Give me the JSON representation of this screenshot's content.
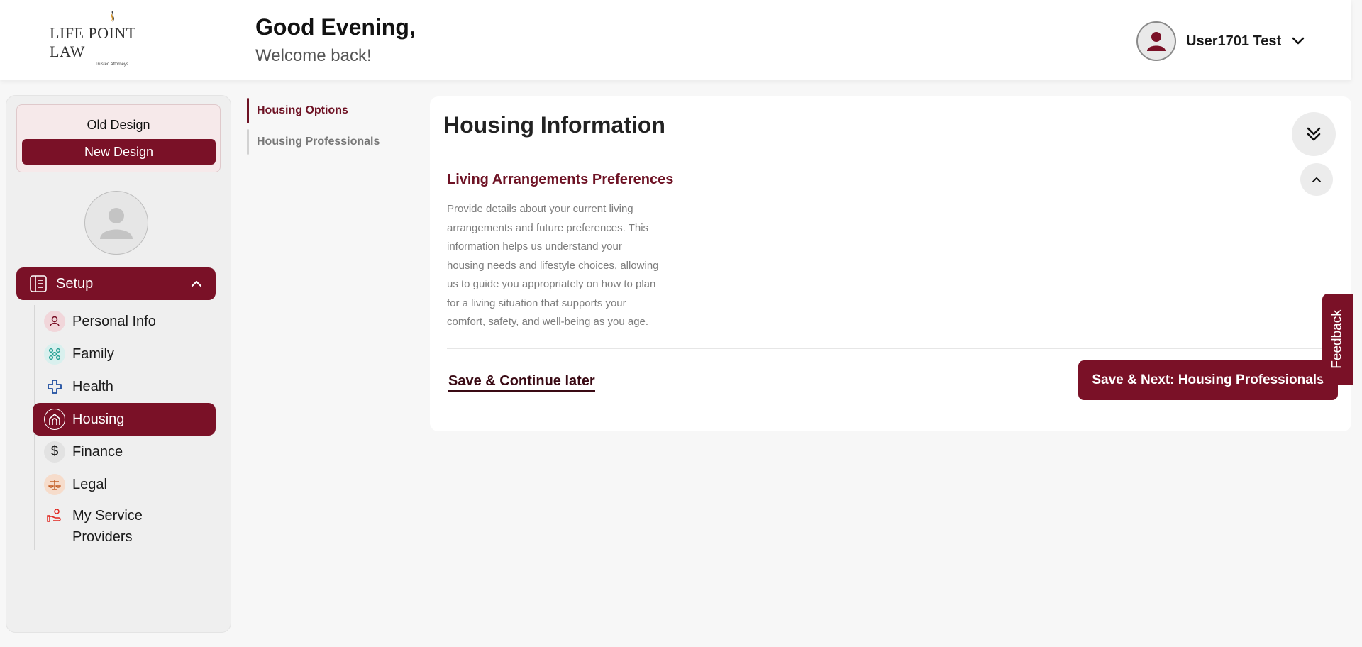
{
  "header": {
    "logo_text": "LIFE POINT LAW",
    "logo_tagline": "Trusted Attorneys",
    "greeting": "Good Evening,",
    "welcome": "Welcome back!",
    "user_name": "User1701 Test"
  },
  "sidebar": {
    "old_design": "Old Design",
    "new_design": "New Design",
    "setup_label": "Setup",
    "items": [
      {
        "label": "Personal Info",
        "icon": "person-icon"
      },
      {
        "label": "Family",
        "icon": "family-icon"
      },
      {
        "label": "Health",
        "icon": "health-cross-icon"
      },
      {
        "label": "Housing",
        "icon": "house-icon",
        "active": true
      },
      {
        "label": "Finance",
        "icon": "dollar-icon"
      },
      {
        "label": "Legal",
        "icon": "scales-icon"
      },
      {
        "label": "My Service Providers",
        "icon": "service-hand-icon"
      }
    ]
  },
  "subnav": {
    "items": [
      {
        "label": "Housing Options",
        "active": true
      },
      {
        "label": "Housing Professionals",
        "active": false
      }
    ]
  },
  "main": {
    "title": "Housing Information",
    "section_title": "Living Arrangements Preferences",
    "section_description": "Provide details about your current living arrangements and future preferences. This information helps us understand your housing needs and lifestyle choices, allowing us to guide you appropriately on how to plan for a living situation that supports your comfort, safety, and well-being as you age.",
    "save_later": "Save & Continue later",
    "save_next": "Save & Next: Housing Professionals"
  },
  "feedback_label": "Feedback",
  "colors": {
    "brand": "#7a1127",
    "brand_text": "#6e1224",
    "background": "#f7f7f7"
  }
}
